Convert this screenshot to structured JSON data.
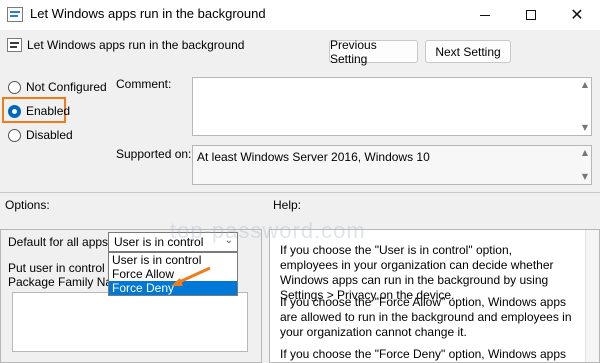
{
  "window": {
    "title": "Let Windows apps run in the background",
    "minimize_icon": "minimize-icon",
    "maximize_icon": "maximize-icon",
    "close_glyph": "✕"
  },
  "policy": {
    "title": "Let Windows apps run in the background"
  },
  "buttons": {
    "previous": "Previous Setting",
    "next": "Next Setting"
  },
  "state": {
    "options": [
      "Not Configured",
      "Enabled",
      "Disabled"
    ],
    "selected": "Enabled"
  },
  "comment": {
    "label": "Comment:",
    "value": ""
  },
  "supported": {
    "label": "Supported on:",
    "value": "At least Windows Server 2016, Windows 10"
  },
  "sections": {
    "options": "Options:",
    "help": "Help:"
  },
  "options_panel": {
    "default_label": "Default for all apps:",
    "dropdown_value": "User is in control",
    "dropdown_items": [
      "User is in control",
      "Force Allow",
      "Force Deny"
    ],
    "highlighted_item": "Force Deny",
    "put_user_line1": "Put user in control of",
    "put_user_line2": "Package Family Name"
  },
  "help": {
    "p1": "If you choose the \"User is in control\" option, employees in your organization can decide whether Windows apps can run in the background by using Settings > Privacy on the device.",
    "p2": "If you choose the \"Force Allow\" option, Windows apps are allowed to run in the background and employees in your organization cannot change it.",
    "p3": "If you choose the \"Force Deny\" option, Windows apps are not"
  },
  "watermark": "top-password.com",
  "colors": {
    "accent": "#0067c0",
    "highlight_border": "#f07d1a",
    "selection": "#0078d7"
  }
}
